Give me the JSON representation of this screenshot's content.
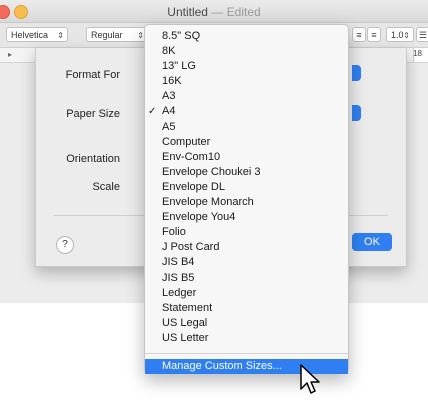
{
  "window": {
    "title": "Untitled",
    "edited": "— Edited"
  },
  "toolbar": {
    "font_family": "Helvetica",
    "font_style": "Regular",
    "spacing": "1.0",
    "ruler_number": "18"
  },
  "sheet": {
    "format_for_label": "Format For",
    "paper_size_label": "Paper Size",
    "orientation_label": "Orientation",
    "scale_label": "Scale",
    "help_label": "?",
    "ok_label": "OK"
  },
  "menu": {
    "items": [
      {
        "label": "8.5\" SQ",
        "checked": false
      },
      {
        "label": "8K",
        "checked": false
      },
      {
        "label": "13\" LG",
        "checked": false
      },
      {
        "label": "16K",
        "checked": false
      },
      {
        "label": "A3",
        "checked": false
      },
      {
        "label": "A4",
        "checked": true
      },
      {
        "label": "A5",
        "checked": false
      },
      {
        "label": "Computer",
        "checked": false
      },
      {
        "label": "Env-Com10",
        "checked": false
      },
      {
        "label": "Envelope Choukei 3",
        "checked": false
      },
      {
        "label": "Envelope DL",
        "checked": false
      },
      {
        "label": "Envelope Monarch",
        "checked": false
      },
      {
        "label": "Envelope You4",
        "checked": false
      },
      {
        "label": "Folio",
        "checked": false
      },
      {
        "label": "J Post Card",
        "checked": false
      },
      {
        "label": "JIS B4",
        "checked": false
      },
      {
        "label": "JIS B5",
        "checked": false
      },
      {
        "label": "Ledger",
        "checked": false
      },
      {
        "label": "Statement",
        "checked": false
      },
      {
        "label": "US Legal",
        "checked": false
      },
      {
        "label": "US Letter",
        "checked": false
      }
    ],
    "manage_label": "Manage Custom Sizes...",
    "check_glyph": "✓"
  },
  "colors": {
    "accent": "#2f7ff3"
  }
}
